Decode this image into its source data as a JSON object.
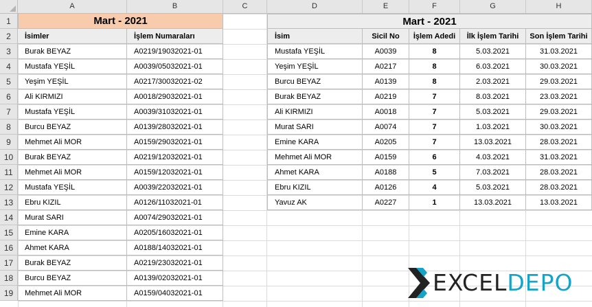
{
  "columns": [
    "A",
    "B",
    "C",
    "D",
    "E",
    "F",
    "G",
    "H"
  ],
  "rows": [
    "1",
    "2",
    "3",
    "4",
    "5",
    "6",
    "7",
    "8",
    "9",
    "10",
    "11",
    "12",
    "13",
    "14",
    "15",
    "16",
    "17",
    "18",
    "19"
  ],
  "left_table": {
    "title": "Mart - 2021",
    "headers": [
      "İsimler",
      "İşlem Numaraları"
    ],
    "rows": [
      [
        "Burak BEYAZ",
        "A0219/19032021-01"
      ],
      [
        "Mustafa YEŞİL",
        "A0039/05032021-01"
      ],
      [
        "Yeşim YEŞİL",
        "A0217/30032021-02"
      ],
      [
        "Ali KIRMIZI",
        "A0018/29032021-01"
      ],
      [
        "Mustafa YEŞİL",
        "A0039/31032021-01"
      ],
      [
        "Burcu BEYAZ",
        "A0139/28032021-01"
      ],
      [
        "Mehmet Ali MOR",
        "A0159/29032021-01"
      ],
      [
        "Burak BEYAZ",
        "A0219/12032021-01"
      ],
      [
        "Mehmet Ali MOR",
        "A0159/12032021-01"
      ],
      [
        "Mustafa YEŞİL",
        "A0039/22032021-01"
      ],
      [
        "Ebru KIZIL",
        "A0126/11032021-01"
      ],
      [
        "Murat SARI",
        "A0074/29032021-01"
      ],
      [
        "Emine KARA",
        "A0205/16032021-01"
      ],
      [
        "Ahmet KARA",
        "A0188/14032021-01"
      ],
      [
        "Burak BEYAZ",
        "A0219/23032021-01"
      ],
      [
        "Burcu BEYAZ",
        "A0139/02032021-01"
      ],
      [
        "Mehmet Ali MOR",
        "A0159/04032021-01"
      ]
    ]
  },
  "right_table": {
    "title": "Mart - 2021",
    "headers": [
      "İsim",
      "Sicil No",
      "İşlem Adedi",
      "İlk İşlem Tarihi",
      "Son İşlem Tarihi"
    ],
    "rows": [
      [
        "Mustafa YEŞİL",
        "A0039",
        "8",
        "5.03.2021",
        "31.03.2021"
      ],
      [
        "Yeşim YEŞİL",
        "A0217",
        "8",
        "6.03.2021",
        "30.03.2021"
      ],
      [
        "Burcu BEYAZ",
        "A0139",
        "8",
        "2.03.2021",
        "29.03.2021"
      ],
      [
        "Burak BEYAZ",
        "A0219",
        "7",
        "8.03.2021",
        "23.03.2021"
      ],
      [
        "Ali KIRMIZI",
        "A0018",
        "7",
        "5.03.2021",
        "29.03.2021"
      ],
      [
        "Murat SARI",
        "A0074",
        "7",
        "1.03.2021",
        "30.03.2021"
      ],
      [
        "Emine KARA",
        "A0205",
        "7",
        "13.03.2021",
        "28.03.2021"
      ],
      [
        "Mehmet Ali MOR",
        "A0159",
        "6",
        "4.03.2021",
        "31.03.2021"
      ],
      [
        "Ahmet KARA",
        "A0188",
        "5",
        "7.03.2021",
        "28.03.2021"
      ],
      [
        "Ebru KIZIL",
        "A0126",
        "4",
        "5.03.2021",
        "28.03.2021"
      ],
      [
        "Yavuz AK",
        "A0227",
        "1",
        "13.03.2021",
        "13.03.2021"
      ]
    ]
  },
  "logo": {
    "part1": "EXCEL",
    "part2": "DEPO",
    "colors": {
      "dark": "#222222",
      "accent": "#17a2c8"
    }
  },
  "colors": {
    "title_orange": "#f8cbad",
    "header_gray": "#ededed",
    "gridline": "#dadada"
  }
}
